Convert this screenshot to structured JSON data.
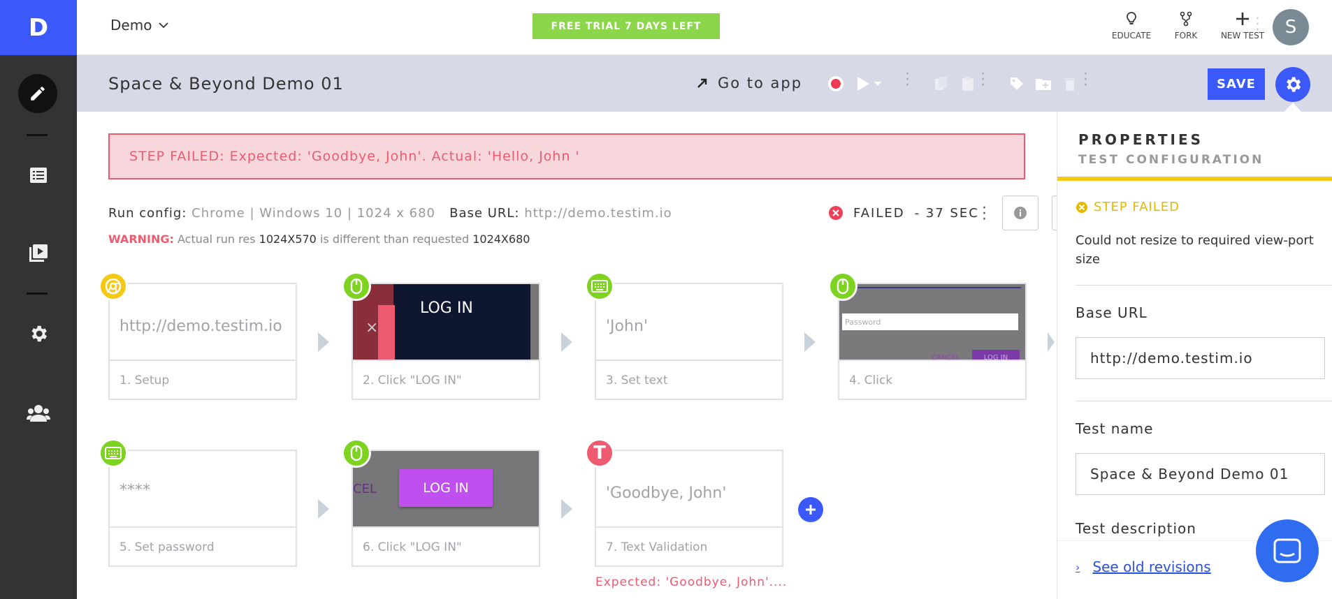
{
  "app": {
    "logo_letter": "D",
    "project_name": "Demo",
    "trial_banner": "FREE TRIAL 7 DAYS LEFT",
    "user_initial": "S",
    "accent": "#3b59f8"
  },
  "top_actions": [
    {
      "label": "EDUCATE",
      "icon": "lightbulb-icon"
    },
    {
      "label": "FORK",
      "icon": "fork-icon"
    },
    {
      "label": "NEW TEST",
      "icon": "plus-icon"
    }
  ],
  "test_header": {
    "title": "Space & Beyond Demo 01",
    "goto_label": "Go to app",
    "save_label": "SAVE"
  },
  "failure_banner": "STEP FAILED: Expected: 'Goodbye, John'. Actual: 'Hello, John '",
  "run_info": {
    "config_label": "Run config:",
    "config_value": "Chrome | Windows 10 | 1024 x 680",
    "base_url_label": "Base URL:",
    "base_url_value": "http://demo.testim.io",
    "warning_label": "WARNING:",
    "warning_text_1": " Actual run res ",
    "actual_res": "1024X570",
    "warning_text_2": " is different than requested ",
    "requested_res": "1024X680",
    "status": "FAILED",
    "duration": "- 37 SEC"
  },
  "steps": [
    {
      "label": "1. Setup",
      "thumb_text": "http://demo.testim.io",
      "badge": "chrome-icon"
    },
    {
      "label": "2. Click \"LOG IN\"",
      "thumb_text": "LOG IN",
      "badge": "mouse-icon"
    },
    {
      "label": "3. Set text",
      "thumb_text": "'John'",
      "badge": "keyboard-icon"
    },
    {
      "label": "4. Click",
      "thumb_text": "Password",
      "thumb_cancel": "CANCEL",
      "thumb_login": "LOG IN",
      "badge": "mouse-icon"
    },
    {
      "label": "5. Set password",
      "thumb_text": "****",
      "badge": "keyboard-icon"
    },
    {
      "label": "6. Click \"LOG IN\"",
      "thumb_text": "LOG IN",
      "thumb_cancel": "CEL",
      "badge": "mouse-icon"
    },
    {
      "label": "7. Text Validation",
      "thumb_text": "'Goodbye, John'",
      "badge": "text-validation-icon",
      "badge_letter": "T"
    }
  ],
  "step_error": "Expected: 'Goodbye, John'....",
  "properties": {
    "title": "PROPERTIES",
    "subtitle": "TEST CONFIGURATION",
    "fail_label": "STEP FAILED",
    "fail_message": "Could not resize to required view-port size",
    "base_url_label": "Base URL",
    "base_url_value": "http://demo.testim.io",
    "test_name_label": "Test name",
    "test_name_value": "Space & Beyond Demo 01",
    "description_label": "Test description",
    "revisions_link": "See old revisions"
  },
  "colors": {
    "fail": "#ee5a6f",
    "warning_yellow": "#f4c815",
    "green_badge": "#7ed321",
    "trial_green": "#8bd64b"
  }
}
